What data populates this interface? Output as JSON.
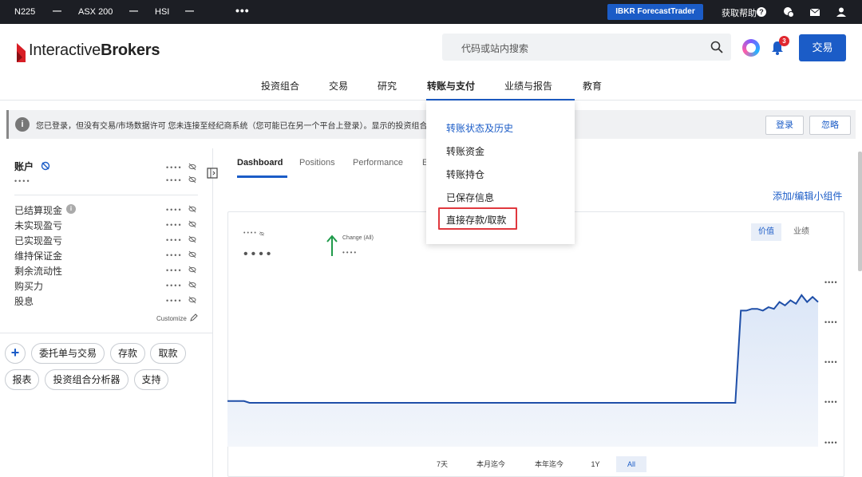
{
  "topbar": {
    "tickers": [
      "N225",
      "ASX 200",
      "HSI"
    ],
    "ticker_value": "—",
    "more": "•••",
    "forecast_button": "IBKR ForecastTrader",
    "help_label": "获取帮助",
    "help_icon": "?"
  },
  "header": {
    "logo_text_a": "Interactive",
    "logo_text_b": "Brokers",
    "search_placeholder": "代码或站内搜索",
    "notification_count": "3",
    "trade_button": "交易"
  },
  "nav": {
    "items": [
      "投资组合",
      "交易",
      "研究",
      "转账与支付",
      "业绩与报告",
      "教育"
    ],
    "active_index": 3
  },
  "banner": {
    "icon": "i",
    "text": "您已登录，但没有交易/市场数据许可 您未连接至经纪商系统（您可能已在另一个平台上登录）。显示的投资组合和",
    "login_button": "登录",
    "ignore_button": "忽略"
  },
  "sidebar": {
    "account_title": "账户",
    "masked": "••••",
    "rows": [
      "已结算现金",
      "未实现盈亏",
      "已实现盈亏",
      "维持保证金",
      "剩余流动性",
      "购买力",
      "股息"
    ],
    "settled_cash_info": "i",
    "customize": "Customize",
    "actions_row1": [
      "委托单与交易",
      "存款",
      "取款"
    ],
    "actions_row2": [
      "报表",
      "投资组合分析器",
      "支持"
    ],
    "plus": "+"
  },
  "tabs": {
    "items": [
      "Dashboard",
      "Positions",
      "Performance",
      "E"
    ]
  },
  "main": {
    "widget_link": "添加/编辑小组件",
    "segment": [
      "价值",
      "业绩"
    ],
    "change_label": "Change (All)",
    "masked_small": "•••• ",
    "masked_dots": "••••",
    "y_masks": [
      "••••",
      "••••",
      "••••",
      "••••",
      "••••"
    ],
    "periods": [
      "7天",
      "本月迄今",
      "本年迄今",
      "1Y",
      "All"
    ],
    "active_period": "All"
  },
  "dropdown": {
    "items": [
      "转账状态及历史",
      "转账资金",
      "转账持仓",
      "已保存信息",
      "直接存款/取款"
    ],
    "highlighted": "转账状态及历史",
    "boxed": "直接存款/取款"
  },
  "colors": {
    "brand_blue": "#1b5cc7",
    "topbar_bg": "#1c1e24",
    "alert_red": "#e0272f",
    "up_green": "#1f9a4a"
  },
  "chart_data": {
    "type": "area",
    "title": "",
    "xlabel": "",
    "ylabel": "",
    "note": "values masked; relative series shape only",
    "series": [
      {
        "values": [
          0.33,
          0.33,
          0.33,
          0.33,
          0.32,
          0.32,
          0.32,
          0.32,
          0.32,
          0.32,
          0.32,
          0.32,
          0.32,
          0.32,
          0.32,
          0.32,
          0.32,
          0.32,
          0.32,
          0.32,
          0.32,
          0.32,
          0.32,
          0.32,
          0.32,
          0.32,
          0.32,
          0.32,
          0.32,
          0.32,
          0.32,
          0.32,
          0.32,
          0.32,
          0.32,
          0.32,
          0.32,
          0.32,
          0.32,
          0.32,
          0.32,
          0.32,
          0.32,
          0.32,
          0.32,
          0.32,
          0.32,
          0.32,
          0.32,
          0.32,
          0.32,
          0.32,
          0.32,
          0.32,
          0.32,
          0.32,
          0.32,
          0.32,
          0.32,
          0.32,
          0.32,
          0.32,
          0.32,
          0.32,
          0.32,
          0.32,
          0.32,
          0.32,
          0.32,
          0.32,
          0.32,
          0.32,
          0.32,
          0.32,
          0.32,
          0.32,
          0.32,
          0.32,
          0.32,
          0.32,
          0.32,
          0.32,
          0.32,
          0.32,
          0.32,
          0.32,
          0.32,
          0.32,
          0.32,
          0.32,
          0.32,
          0.32,
          0.32,
          0.95,
          0.95,
          0.96,
          0.96,
          0.95,
          0.97,
          0.96,
          1.0,
          0.98,
          1.01,
          0.99,
          1.04,
          1.0,
          1.03,
          1.0
        ]
      }
    ]
  }
}
